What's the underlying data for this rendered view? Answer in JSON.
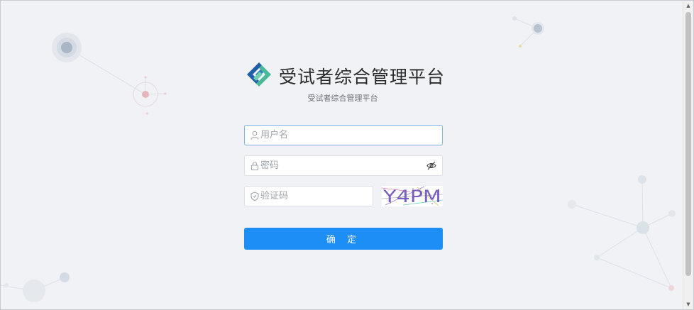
{
  "app": {
    "title": "受试者综合管理平台",
    "subtitle": "受试者综合管理平台"
  },
  "form": {
    "username_placeholder": "用户名",
    "password_placeholder": "密码",
    "captcha_placeholder": "验证码",
    "captcha_text": "Y4PM",
    "submit_label": "确 定"
  },
  "icons": {
    "logo": "app-logo",
    "username": "user-icon",
    "password": "lock-icon",
    "captcha": "shield-icon",
    "toggle": "eye-off-icon"
  },
  "colors": {
    "background": "#f0f2f5",
    "primary": "#1e8ef7",
    "logo_dark": "#1f5fa8",
    "logo_light": "#4bb89a"
  }
}
